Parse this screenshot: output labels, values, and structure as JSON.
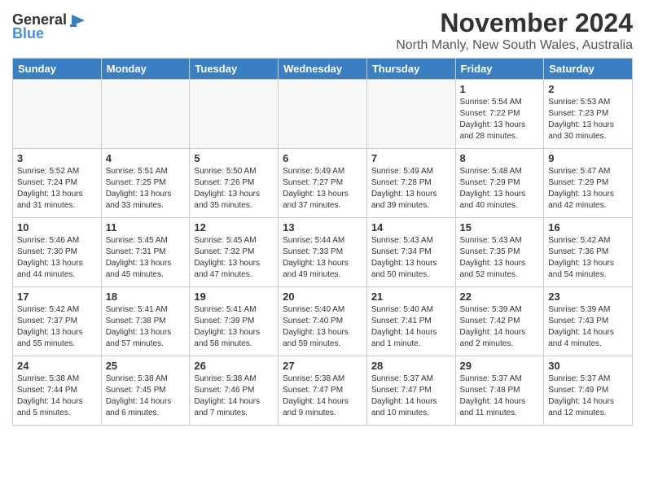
{
  "header": {
    "logo": {
      "general": "General",
      "blue": "Blue",
      "icon": "▶"
    },
    "month": "November 2024",
    "location": "North Manly, New South Wales, Australia"
  },
  "weekdays": [
    "Sunday",
    "Monday",
    "Tuesday",
    "Wednesday",
    "Thursday",
    "Friday",
    "Saturday"
  ],
  "weeks": [
    [
      {
        "day": "",
        "info": ""
      },
      {
        "day": "",
        "info": ""
      },
      {
        "day": "",
        "info": ""
      },
      {
        "day": "",
        "info": ""
      },
      {
        "day": "",
        "info": ""
      },
      {
        "day": "1",
        "info": "Sunrise: 5:54 AM\nSunset: 7:22 PM\nDaylight: 13 hours\nand 28 minutes."
      },
      {
        "day": "2",
        "info": "Sunrise: 5:53 AM\nSunset: 7:23 PM\nDaylight: 13 hours\nand 30 minutes."
      }
    ],
    [
      {
        "day": "3",
        "info": "Sunrise: 5:52 AM\nSunset: 7:24 PM\nDaylight: 13 hours\nand 31 minutes."
      },
      {
        "day": "4",
        "info": "Sunrise: 5:51 AM\nSunset: 7:25 PM\nDaylight: 13 hours\nand 33 minutes."
      },
      {
        "day": "5",
        "info": "Sunrise: 5:50 AM\nSunset: 7:26 PM\nDaylight: 13 hours\nand 35 minutes."
      },
      {
        "day": "6",
        "info": "Sunrise: 5:49 AM\nSunset: 7:27 PM\nDaylight: 13 hours\nand 37 minutes."
      },
      {
        "day": "7",
        "info": "Sunrise: 5:49 AM\nSunset: 7:28 PM\nDaylight: 13 hours\nand 39 minutes."
      },
      {
        "day": "8",
        "info": "Sunrise: 5:48 AM\nSunset: 7:29 PM\nDaylight: 13 hours\nand 40 minutes."
      },
      {
        "day": "9",
        "info": "Sunrise: 5:47 AM\nSunset: 7:29 PM\nDaylight: 13 hours\nand 42 minutes."
      }
    ],
    [
      {
        "day": "10",
        "info": "Sunrise: 5:46 AM\nSunset: 7:30 PM\nDaylight: 13 hours\nand 44 minutes."
      },
      {
        "day": "11",
        "info": "Sunrise: 5:45 AM\nSunset: 7:31 PM\nDaylight: 13 hours\nand 45 minutes."
      },
      {
        "day": "12",
        "info": "Sunrise: 5:45 AM\nSunset: 7:32 PM\nDaylight: 13 hours\nand 47 minutes."
      },
      {
        "day": "13",
        "info": "Sunrise: 5:44 AM\nSunset: 7:33 PM\nDaylight: 13 hours\nand 49 minutes."
      },
      {
        "day": "14",
        "info": "Sunrise: 5:43 AM\nSunset: 7:34 PM\nDaylight: 13 hours\nand 50 minutes."
      },
      {
        "day": "15",
        "info": "Sunrise: 5:43 AM\nSunset: 7:35 PM\nDaylight: 13 hours\nand 52 minutes."
      },
      {
        "day": "16",
        "info": "Sunrise: 5:42 AM\nSunset: 7:36 PM\nDaylight: 13 hours\nand 54 minutes."
      }
    ],
    [
      {
        "day": "17",
        "info": "Sunrise: 5:42 AM\nSunset: 7:37 PM\nDaylight: 13 hours\nand 55 minutes."
      },
      {
        "day": "18",
        "info": "Sunrise: 5:41 AM\nSunset: 7:38 PM\nDaylight: 13 hours\nand 57 minutes."
      },
      {
        "day": "19",
        "info": "Sunrise: 5:41 AM\nSunset: 7:39 PM\nDaylight: 13 hours\nand 58 minutes."
      },
      {
        "day": "20",
        "info": "Sunrise: 5:40 AM\nSunset: 7:40 PM\nDaylight: 13 hours\nand 59 minutes."
      },
      {
        "day": "21",
        "info": "Sunrise: 5:40 AM\nSunset: 7:41 PM\nDaylight: 14 hours\nand 1 minute."
      },
      {
        "day": "22",
        "info": "Sunrise: 5:39 AM\nSunset: 7:42 PM\nDaylight: 14 hours\nand 2 minutes."
      },
      {
        "day": "23",
        "info": "Sunrise: 5:39 AM\nSunset: 7:43 PM\nDaylight: 14 hours\nand 4 minutes."
      }
    ],
    [
      {
        "day": "24",
        "info": "Sunrise: 5:38 AM\nSunset: 7:44 PM\nDaylight: 14 hours\nand 5 minutes."
      },
      {
        "day": "25",
        "info": "Sunrise: 5:38 AM\nSunset: 7:45 PM\nDaylight: 14 hours\nand 6 minutes."
      },
      {
        "day": "26",
        "info": "Sunrise: 5:38 AM\nSunset: 7:46 PM\nDaylight: 14 hours\nand 7 minutes."
      },
      {
        "day": "27",
        "info": "Sunrise: 5:38 AM\nSunset: 7:47 PM\nDaylight: 14 hours\nand 9 minutes."
      },
      {
        "day": "28",
        "info": "Sunrise: 5:37 AM\nSunset: 7:47 PM\nDaylight: 14 hours\nand 10 minutes."
      },
      {
        "day": "29",
        "info": "Sunrise: 5:37 AM\nSunset: 7:48 PM\nDaylight: 14 hours\nand 11 minutes."
      },
      {
        "day": "30",
        "info": "Sunrise: 5:37 AM\nSunset: 7:49 PM\nDaylight: 14 hours\nand 12 minutes."
      }
    ]
  ]
}
